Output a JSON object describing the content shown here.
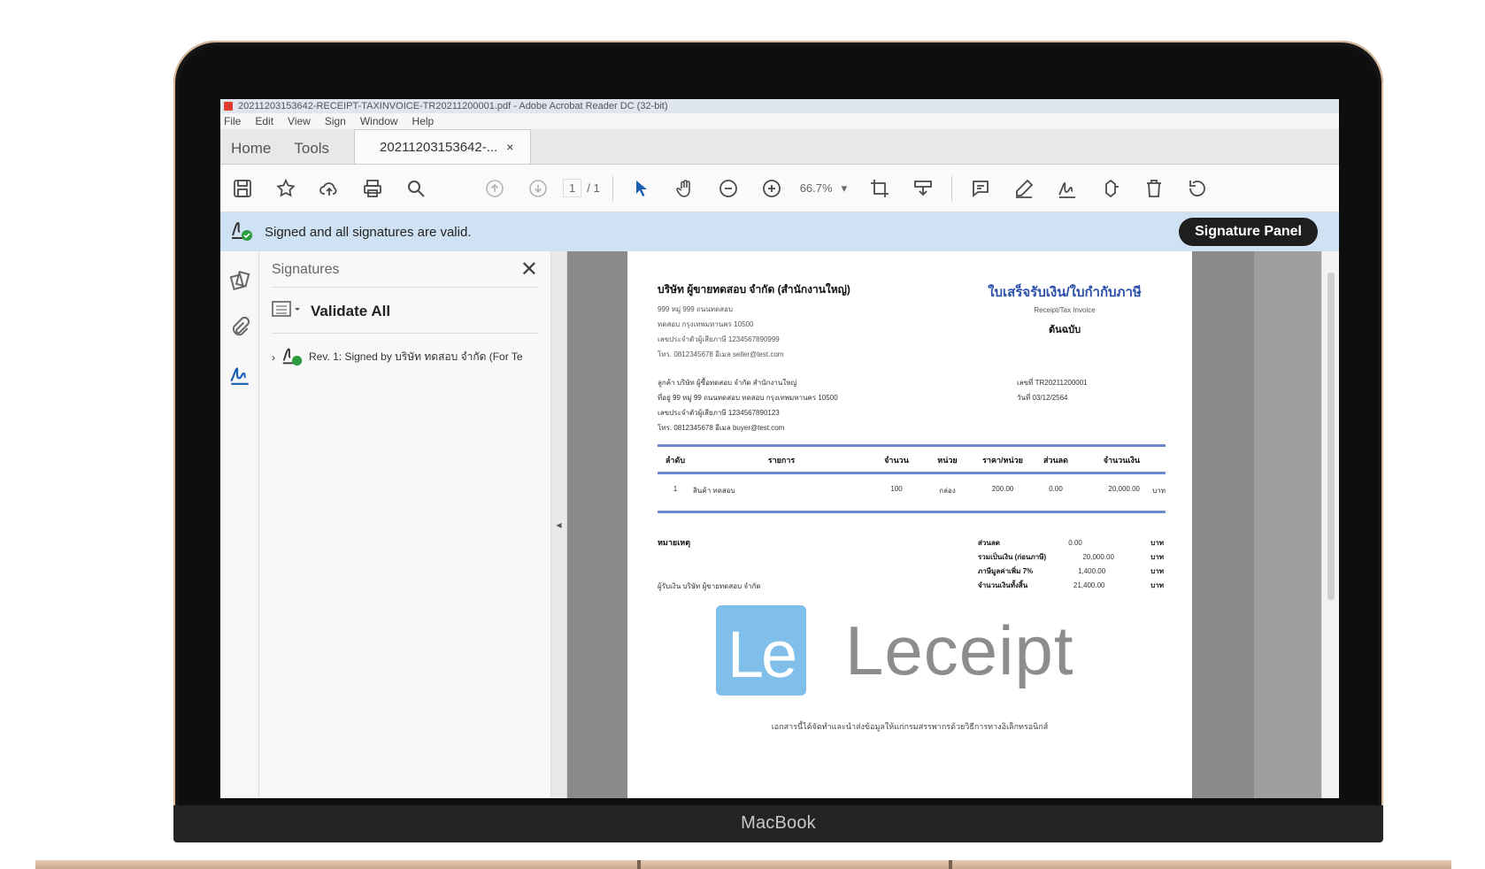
{
  "device": {
    "label": "MacBook"
  },
  "window": {
    "title": "20211203153642-RECEIPT-TAXINVOICE-TR20211200001.pdf - Adobe Acrobat Reader DC (32-bit)"
  },
  "menu": [
    "File",
    "Edit",
    "View",
    "Sign",
    "Window",
    "Help"
  ],
  "tabs": {
    "home": "Home",
    "tools": "Tools",
    "document": "20211203153642-...",
    "close": "×"
  },
  "toolbar": {
    "page_current": "1",
    "page_total": "/ 1",
    "zoom": "66.7%",
    "icons": [
      "save-icon",
      "bookmark-star-icon",
      "upload-cloud-icon",
      "print-icon",
      "search-icon",
      "page-up-icon",
      "page-down-icon",
      "select-arrow-icon",
      "hand-icon",
      "zoom-out-icon",
      "zoom-in-icon",
      "zoom-dropdown-icon",
      "crop-icon",
      "stamp-icon",
      "comment-icon",
      "pen-icon",
      "sign-icon",
      "share-icon",
      "delete-icon",
      "undo-icon"
    ]
  },
  "signature_bar": {
    "message": "Signed and all signatures are valid.",
    "button": "Signature Panel"
  },
  "signatures_panel": {
    "title": "Signatures",
    "validate": "Validate All",
    "entry": "Rev. 1: Signed by บริษัท ทดสอบ จำกัด (For Te"
  },
  "invoice": {
    "company": "บริษัท ผู้ขายทดสอบ จำกัด (สำนักงานใหญ่)",
    "company_lines": [
      "999 หมู่ 999 ถนนทดสอบ",
      "ทดสอบ กรุงเทพมหานคร 10500",
      "เลขประจำตัวผู้เสียภาษี 1234567890999",
      "โทร. 0812345678  อีเมล seller@test.com"
    ],
    "doc_title": "ใบเสร็จรับเงิน/ใบกำกับภาษี",
    "doc_subtitle": "Receipt/Tax Invoice",
    "original": "ต้นฉบับ",
    "customer_lines": [
      "ลูกค้า บริษัท ผู้ซื้อทดสอบ จำกัด สำนักงานใหญ่",
      "ที่อยู่ 99 หมู่ 99 ถนนทดสอบ ทดสอบ กรุงเทพมหานคร 10500",
      "เลขประจำตัวผู้เสียภาษี 1234567890123",
      "โทร. 0812345678  อีเมล buyer@test.com"
    ],
    "meta_lines": [
      "เลขที่ TR20211200001",
      "วันที่ 03/12/2564"
    ],
    "headers": [
      "ลำดับ",
      "รายการ",
      "จำนวน",
      "หน่วย",
      "ราคา/หน่วย",
      "ส่วนลด",
      "จำนวนเงิน",
      ""
    ],
    "rows": [
      [
        "1",
        "สินค้า ทดสอบ",
        "100",
        "กล่อง",
        "200.00",
        "0.00",
        "20,000.00",
        "บาท"
      ]
    ],
    "note_label": "หมายเหตุ",
    "payee": "ผู้รับเงิน บริษัท ผู้ขายทดสอบ จำกัด",
    "totals": [
      [
        "ส่วนลด",
        "0.00",
        "บาท"
      ],
      [
        "รวมเป็นเงิน (ก่อนภาษี)",
        "20,000.00",
        "บาท"
      ],
      [
        "ภาษีมูลค่าเพิ่ม 7%",
        "1,400.00",
        "บาท"
      ],
      [
        "จำนวนเงินทั้งสิ้น",
        "21,400.00",
        "บาท"
      ]
    ],
    "logo_mark": "Le",
    "logo_word": "Leceipt",
    "footer": "เอกสารนี้ได้จัดทำและนำส่งข้อมูลให้แก่กรมสรรพากรด้วยวิธีการทางอิเล็กทรอนิกส์"
  }
}
